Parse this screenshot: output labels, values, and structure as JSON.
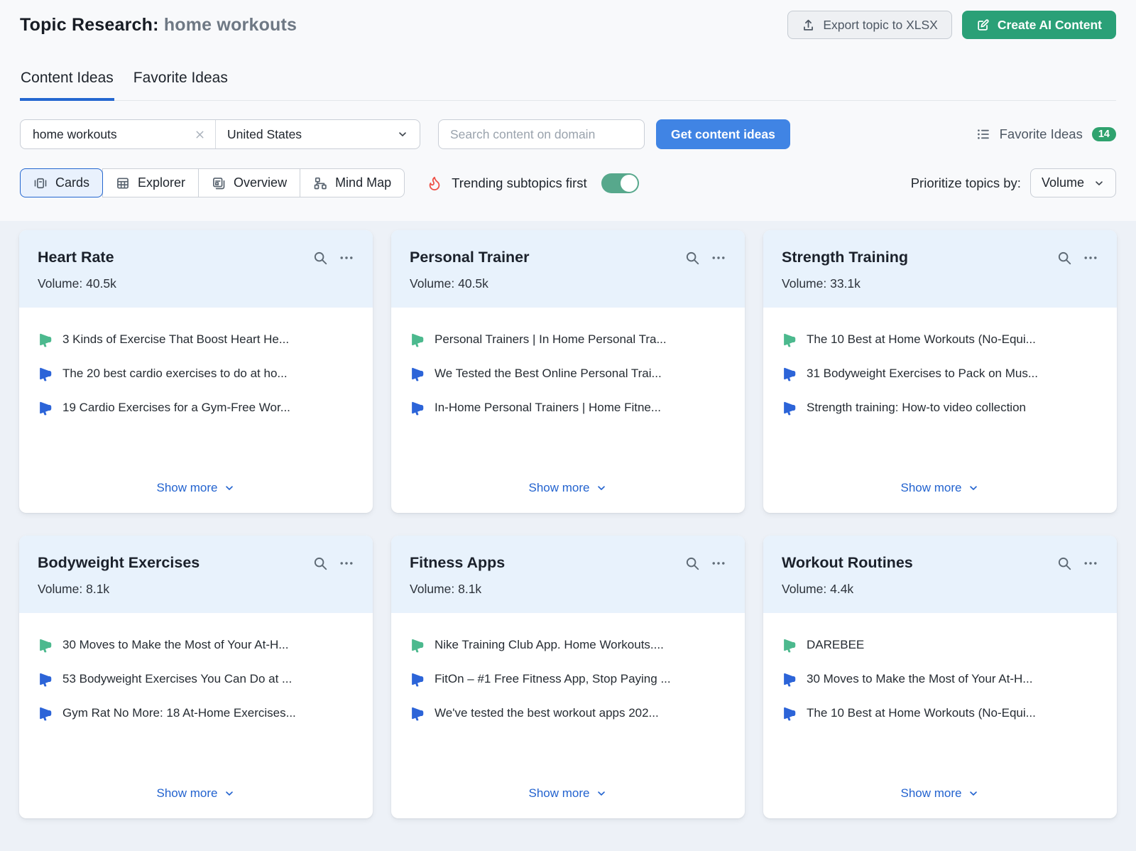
{
  "header": {
    "title_prefix": "Topic Research: ",
    "title_query": "home workouts",
    "export_button": "Export topic to XLSX",
    "create_ai_button": "Create AI Content"
  },
  "tabs": {
    "content_ideas": "Content Ideas",
    "favorite_ideas": "Favorite Ideas"
  },
  "filters": {
    "keyword_value": "home workouts",
    "country_value": "United States",
    "domain_placeholder": "Search content on domain",
    "get_ideas_button": "Get content ideas",
    "favorites_link": "Favorite Ideas",
    "favorites_count": "14",
    "views": {
      "cards": "Cards",
      "explorer": "Explorer",
      "overview": "Overview",
      "mindmap": "Mind Map"
    },
    "trending_label": "Trending subtopics first",
    "trending_state": "on",
    "prioritize_label": "Prioritize topics by:",
    "prioritize_value": "Volume"
  },
  "cards": [
    {
      "title": "Heart Rate",
      "volume_label": "Volume:",
      "volume": "40.5k",
      "show_more": "Show more",
      "items": [
        {
          "text": "3 Kinds of Exercise That Boost Heart He...",
          "trend": "green"
        },
        {
          "text": "The 20 best cardio exercises to do at ho...",
          "trend": "blue"
        },
        {
          "text": "19 Cardio Exercises for a Gym-Free Wor...",
          "trend": "blue"
        }
      ]
    },
    {
      "title": "Personal Trainer",
      "volume_label": "Volume:",
      "volume": "40.5k",
      "show_more": "Show more",
      "items": [
        {
          "text": "Personal Trainers | In Home Personal Tra...",
          "trend": "green"
        },
        {
          "text": "We Tested the Best Online Personal Trai...",
          "trend": "blue"
        },
        {
          "text": "In-Home Personal Trainers | Home Fitne...",
          "trend": "blue"
        }
      ]
    },
    {
      "title": "Strength Training",
      "volume_label": "Volume:",
      "volume": "33.1k",
      "show_more": "Show more",
      "items": [
        {
          "text": "The 10 Best at Home Workouts (No-Equi...",
          "trend": "green"
        },
        {
          "text": "31 Bodyweight Exercises to Pack on Mus...",
          "trend": "blue"
        },
        {
          "text": "Strength training: How-to video collection",
          "trend": "blue"
        }
      ]
    },
    {
      "title": "Bodyweight Exercises",
      "volume_label": "Volume:",
      "volume": "8.1k",
      "show_more": "Show more",
      "items": [
        {
          "text": "30 Moves to Make the Most of Your At-H...",
          "trend": "green"
        },
        {
          "text": "53 Bodyweight Exercises You Can Do at ...",
          "trend": "blue"
        },
        {
          "text": "Gym Rat No More: 18 At-Home Exercises...",
          "trend": "blue"
        }
      ]
    },
    {
      "title": "Fitness Apps",
      "volume_label": "Volume:",
      "volume": "8.1k",
      "show_more": "Show more",
      "items": [
        {
          "text": "Nike Training Club App. Home Workouts....",
          "trend": "green"
        },
        {
          "text": "FitOn – #1 Free Fitness App, Stop Paying ...",
          "trend": "blue"
        },
        {
          "text": "We've tested the best workout apps 202...",
          "trend": "blue"
        }
      ]
    },
    {
      "title": "Workout Routines",
      "volume_label": "Volume:",
      "volume": "4.4k",
      "show_more": "Show more",
      "items": [
        {
          "text": "DAREBEE",
          "trend": "green"
        },
        {
          "text": "30 Moves to Make the Most of Your At-H...",
          "trend": "blue"
        },
        {
          "text": "The 10 Best at Home Workouts (No-Equi...",
          "trend": "blue"
        }
      ]
    }
  ],
  "colors": {
    "accent_blue": "#4084e4",
    "link_blue": "#2363cf",
    "brand_green": "#2aa077",
    "badge_green": "#2fa26e",
    "toggle_green": "#57a88c",
    "flame_red": "#ee5248",
    "megaphone_green": "#4cb98e",
    "megaphone_blue": "#2c64d8",
    "card_header_bg": "#e8f2fc",
    "page_bg": "#edf1f7"
  }
}
